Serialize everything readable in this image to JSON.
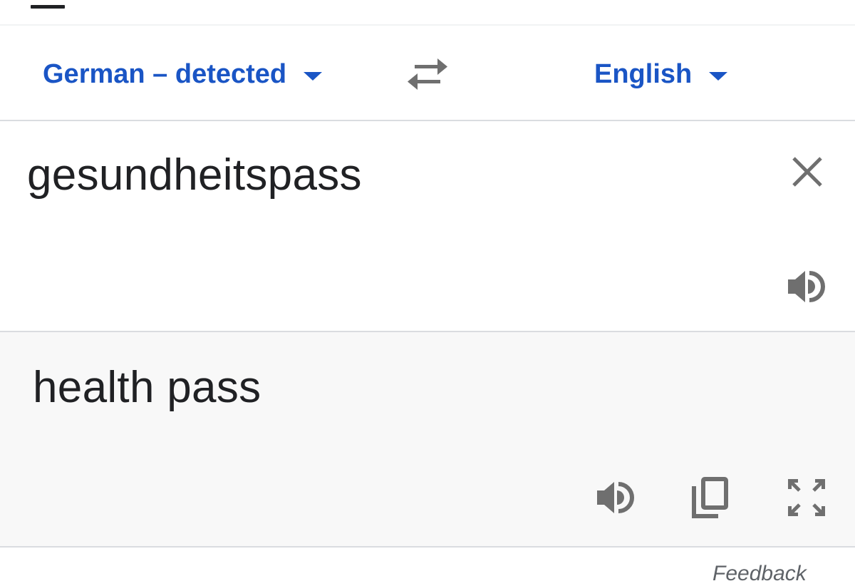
{
  "source_language": {
    "label": "German – detected"
  },
  "target_language": {
    "label": "English"
  },
  "input": {
    "text": "gesundheitspass"
  },
  "output": {
    "text": "health pass"
  },
  "footer": {
    "feedback_label": "Feedback"
  },
  "icons": {
    "swap": "swap-languages-icon",
    "clear": "close-icon",
    "listen_source": "speaker-icon",
    "listen_translation": "speaker-icon",
    "copy": "copy-icon",
    "fullscreen": "fullscreen-icon"
  },
  "colors": {
    "accent": "#1a55c5",
    "text": "#202124",
    "icon": "#6f6f6f",
    "output_background": "#f8f8f8",
    "divider": "#dadce0"
  }
}
